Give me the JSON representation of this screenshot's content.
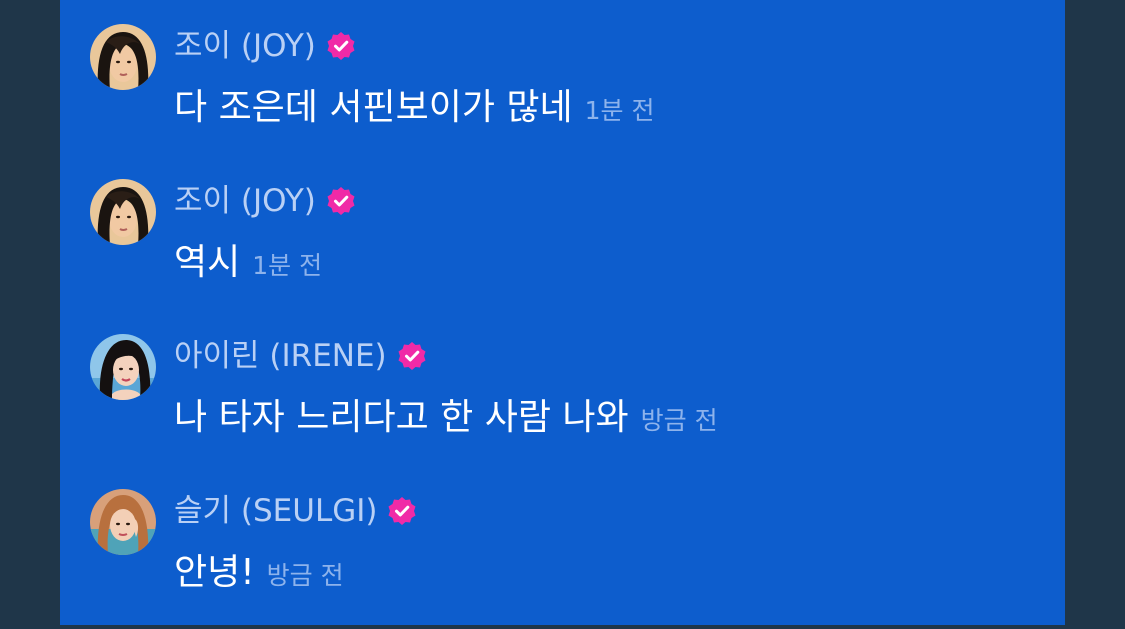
{
  "colors": {
    "panel_background": "#0d5dcd",
    "side_background": "#1f3649",
    "name_text": "#b9d0f5",
    "message_text": "#ffffff",
    "timestamp_text": "#8db3ec",
    "verified_badge": "#f02aa7"
  },
  "messages": [
    {
      "author": "조이 (JOY)",
      "verified": true,
      "avatar_icon": "joy-avatar",
      "text": "다 조은데 서핀보이가 많네",
      "time": "1분 전"
    },
    {
      "author": "조이 (JOY)",
      "verified": true,
      "avatar_icon": "joy-avatar",
      "text": "역시",
      "time": "1분 전"
    },
    {
      "author": "아이린 (IRENE)",
      "verified": true,
      "avatar_icon": "irene-avatar",
      "text": "나 타자 느리다고 한 사람 나와",
      "time": "방금 전"
    },
    {
      "author": "슬기 (SEULGI)",
      "verified": true,
      "avatar_icon": "seulgi-avatar",
      "text": "안녕!",
      "time": "방금 전"
    }
  ]
}
